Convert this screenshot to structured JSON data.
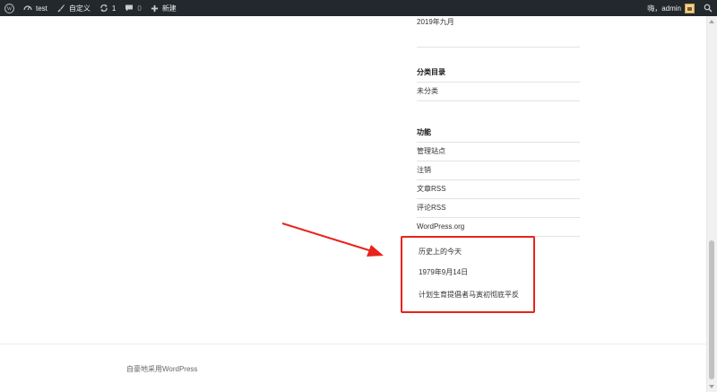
{
  "adminbar": {
    "site_name": "test",
    "customize": "自定义",
    "updates_count": "1",
    "comments_count": "0",
    "new": "新建",
    "greeting": "嗨，admin"
  },
  "sidebar": {
    "archive_item": "2019年九月",
    "categories_title": "分类目录",
    "categories": [
      "未分类"
    ],
    "meta_title": "功能",
    "meta_links": [
      "管理站点",
      "注销",
      "文章RSS",
      "评论RSS",
      "WordPress.org"
    ]
  },
  "history_widget": {
    "title": "历史上的今天",
    "date": "1979年9月14日",
    "event": "计划生育提倡者马寅初彻底平反"
  },
  "footer": {
    "text": "自豪地采用WordPress"
  },
  "colors": {
    "adminbar_bg": "#23282d",
    "highlight": "#e8231b",
    "arrow": "#e8231b"
  }
}
